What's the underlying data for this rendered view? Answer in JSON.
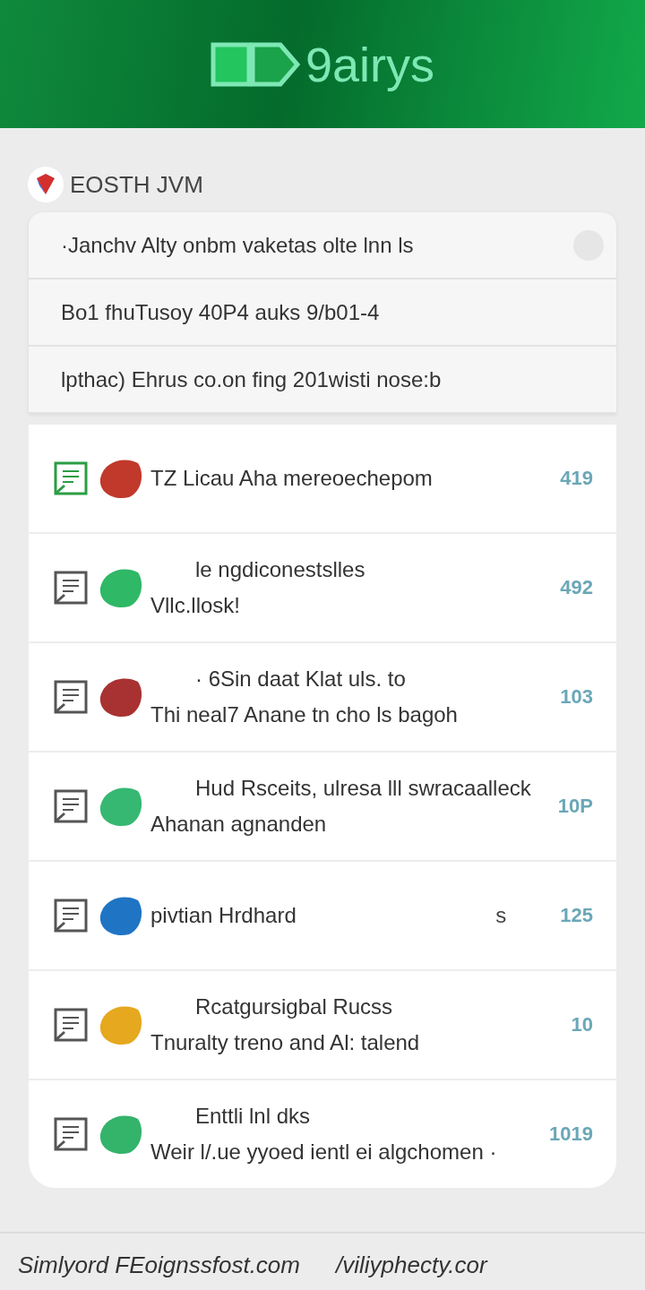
{
  "header": {
    "logo_text": "9airys"
  },
  "section": {
    "title": "EOSTH JVM"
  },
  "filters": [
    {
      "text": "·Janchv Alty onbm vaketas olte lnn ls",
      "has_button": true
    },
    {
      "text": "Bo1 fhuTusoy 40P4 auks 9/b01-4",
      "has_button": false
    },
    {
      "text": "lpthac) Ehrus co.on fing 201wisti nose:b",
      "has_button": false
    }
  ],
  "items": [
    {
      "lines": [
        "TZ Licau Aha mereoechepom"
      ],
      "count": "419",
      "color": "#c0392b",
      "unread": true
    },
    {
      "lines": [
        "le ngdiconestslles",
        "Vllc.llosk!"
      ],
      "count": "492",
      "color": "#2fb865",
      "unread": false
    },
    {
      "lines": [
        "· 6Sin daat Klat uls. to",
        "Thi neal7 Anane tn cho ls bagoh"
      ],
      "count": "103",
      "color": "#a83232",
      "unread": false
    },
    {
      "lines": [
        "Hud Rsceits, ulresa lll swracaalleck",
        "Ahanan agnanden"
      ],
      "count": "10P",
      "color": "#36b872",
      "unread": false
    },
    {
      "lines": [
        "pivtian Hrdhard"
      ],
      "note": "s",
      "count": "125",
      "color": "#1f74c4",
      "unread": false
    },
    {
      "lines": [
        "Rcatgursigbal Rucss",
        "Tnuralty treno and Al: talend"
      ],
      "count": "10",
      "color": "#e5a81e",
      "unread": false
    },
    {
      "lines": [
        "Enttli lnl dks",
        "Weir l/.ue yyoed ientl ei algchomen ·"
      ],
      "count": "1019",
      "color": "#34b36b",
      "unread": false
    }
  ],
  "footer": {
    "left": "Simlyord FEoignssfost.com",
    "right": "/viliyphecty.cor"
  }
}
